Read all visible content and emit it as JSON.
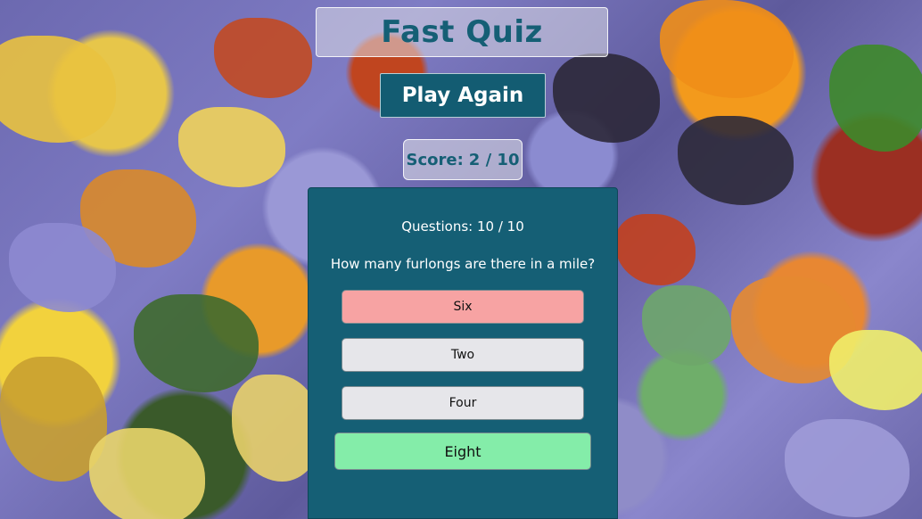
{
  "header": {
    "title": "Fast Quiz",
    "play_again_label": "Play Again"
  },
  "score": {
    "label": "Score:",
    "value": "2 / 10"
  },
  "quiz": {
    "progress_label": "Questions:",
    "progress_value": "10 / 10",
    "question": "How many furlongs are there in a mile?",
    "answers": [
      {
        "label": "Six",
        "state": "wrong"
      },
      {
        "label": "Two",
        "state": "neutral"
      },
      {
        "label": "Four",
        "state": "neutral"
      },
      {
        "label": "Eight",
        "state": "correct"
      }
    ]
  },
  "colors": {
    "accent": "#155f75",
    "wrong": "#f7a3a3",
    "correct": "#84eda9",
    "neutral": "#e6e6ea"
  }
}
